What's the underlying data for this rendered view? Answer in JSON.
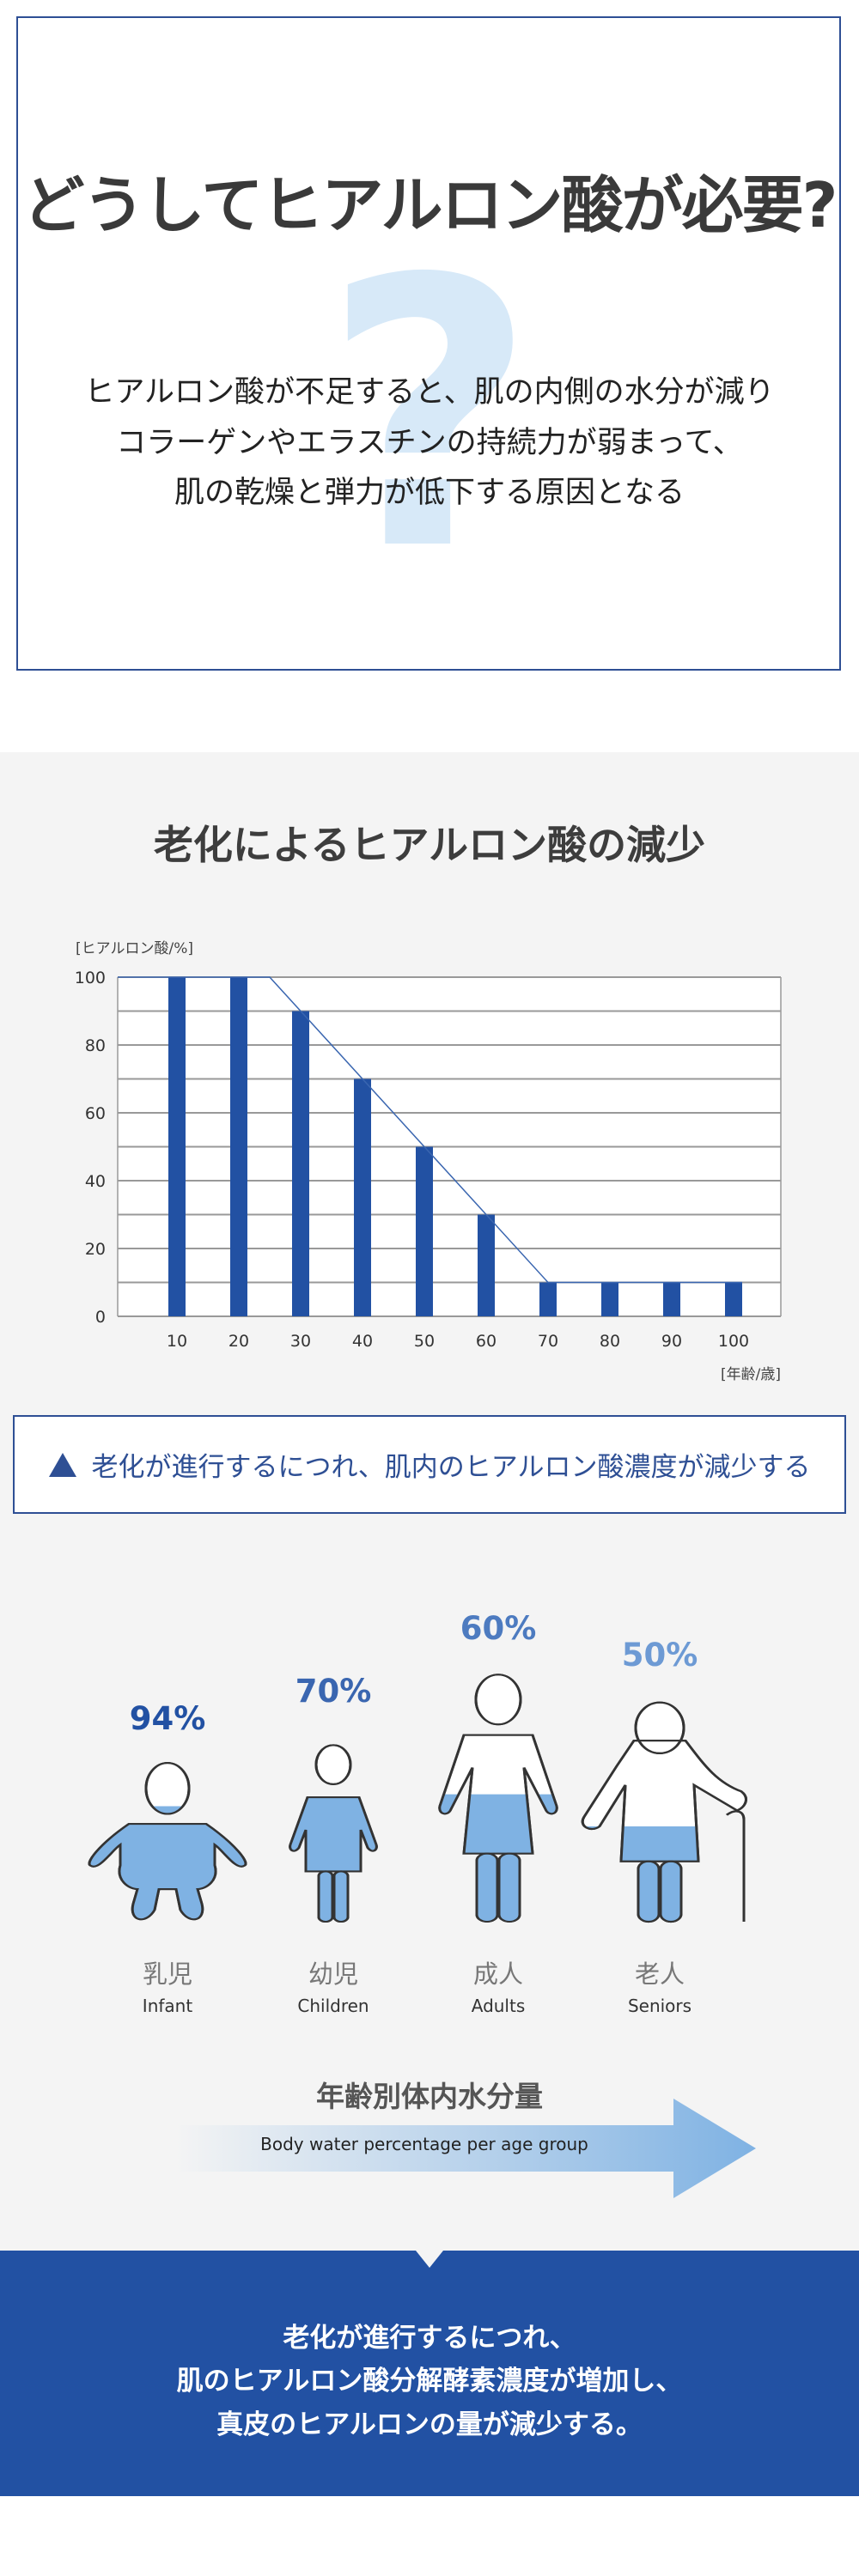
{
  "intro": {
    "title": "どうしてヒアルロン酸が必要?",
    "qmark": "?",
    "lines": [
      "ヒアルロン酸が不足すると、肌の内側の水分が減り",
      "コラーゲンやエラスチンの持続力が弱まって、",
      "肌の乾燥と弾力が低下する原因となる"
    ],
    "qmark_color": "#d7e9f8"
  },
  "decline": {
    "title": "老化によるヒアルロン酸の減少"
  },
  "chart_data": {
    "type": "bar",
    "ylabel": "[ヒアルロン酸/%]",
    "xlabel": "[年齢/歳]",
    "categories": [
      "10",
      "20",
      "30",
      "40",
      "50",
      "60",
      "70",
      "80",
      "90",
      "100"
    ],
    "values": [
      100,
      100,
      90,
      70,
      50,
      30,
      10,
      10,
      10,
      10
    ],
    "trend_line": [
      [
        0,
        100
      ],
      [
        25,
        100
      ],
      [
        70,
        10
      ],
      [
        100,
        10
      ]
    ],
    "yticks": [
      "0",
      "20",
      "40",
      "60",
      "80",
      "100"
    ],
    "ylim": [
      0,
      100
    ],
    "grid": true,
    "bar_color": "#2251a3"
  },
  "note": {
    "text": "老化が進行するにつれ、肌内のヒアルロン酸濃度が減少する"
  },
  "water": {
    "groups": [
      {
        "pct": "94%",
        "jp": "乳児",
        "en": "Infant",
        "level": 94,
        "color": "#2251a3"
      },
      {
        "pct": "70%",
        "jp": "幼児",
        "en": "Children",
        "level": 70,
        "color": "#3a66b0"
      },
      {
        "pct": "60%",
        "jp": "成人",
        "en": "Adults",
        "level": 60,
        "color": "#4d7bc0"
      },
      {
        "pct": "50%",
        "jp": "老人",
        "en": "Seniors",
        "level": 50,
        "color": "#6d9ad4"
      }
    ],
    "title": "年齢別体内水分量",
    "arrow_label": "Body water percentage per age group"
  },
  "conclusion": {
    "lines": [
      "老化が進行するにつれ、",
      "肌のヒアルロン酸分解酵素濃度が増加し、",
      "真皮のヒアルロンの量が減少する。"
    ]
  }
}
